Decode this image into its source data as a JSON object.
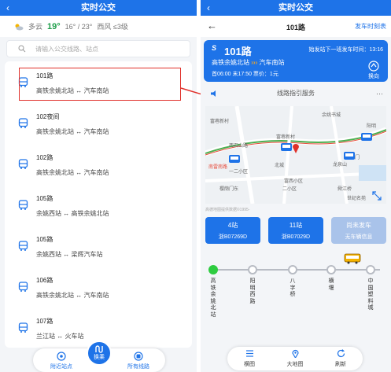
{
  "left": {
    "title": "实时公交",
    "back_icon": "‹",
    "weather": {
      "condition": "多云",
      "temp": "19°",
      "range": "16° / 23°",
      "wind": "西风 ≤3级"
    },
    "search": {
      "placeholder": "请输入公交线路、站点"
    },
    "routes": [
      {
        "name": "101路",
        "stops": "高铁余姚北站 ↔ 汽车南站"
      },
      {
        "name": "102夜间",
        "stops": "高铁余姚北站 ↔ 汽车南站"
      },
      {
        "name": "102路",
        "stops": "高铁余姚北站 ↔ 汽车南站"
      },
      {
        "name": "105路",
        "stops": "余姚西站 ↔ 高铁余姚北站"
      },
      {
        "name": "105路",
        "stops": "余姚西站 ↔ 梁辉汽车站"
      },
      {
        "name": "106路",
        "stops": "高铁余姚北站 ↔ 汽车南站"
      },
      {
        "name": "107路",
        "stops": "兰江站 ↔ 火车站"
      }
    ],
    "nav": {
      "nearby": "附近站点",
      "transfer": "换乘",
      "all_lines": "所有线路"
    }
  },
  "right": {
    "route_title": "101路",
    "schedule_link": "发车时刻表",
    "card": {
      "route": "101路",
      "next_label": "始发站下一班发车时间：13:16",
      "from": "高铁余姚北站",
      "to": "汽车南站",
      "hours": "首06:00  末17:50  票价：1元",
      "reverse": "换向"
    },
    "service": "线路指引服务",
    "more": "···",
    "map": {
      "labels": [
        "余姚书城",
        "富巷新村",
        "阳明",
        "西石山路",
        "富巷新村",
        "老西门",
        "龙泉山",
        "一二小区",
        "二小区",
        "富西小区",
        "樱荫门东",
        "舜江桥",
        "世纪名苑",
        "南雷南路",
        "北城"
      ],
      "copyright": "高德地图提供数据©1995-"
    },
    "buses": [
      {
        "stops": "4站",
        "plate": "浙B07269D"
      },
      {
        "stops": "11站",
        "plate": "浙B07029D"
      },
      {
        "stops": "尚未发车",
        "plate": "无车辆信息"
      }
    ],
    "stops": [
      "高铁余姚北站",
      "阳明西路",
      "八字桥",
      "横堰",
      "中国塑料城"
    ],
    "bottom": {
      "view": "横图",
      "map": "大地图",
      "refresh": "刷新"
    }
  },
  "colors": {
    "primary": "#1e73e8",
    "highlight": "#e0302a",
    "grey_card": "#a9c3ea"
  }
}
